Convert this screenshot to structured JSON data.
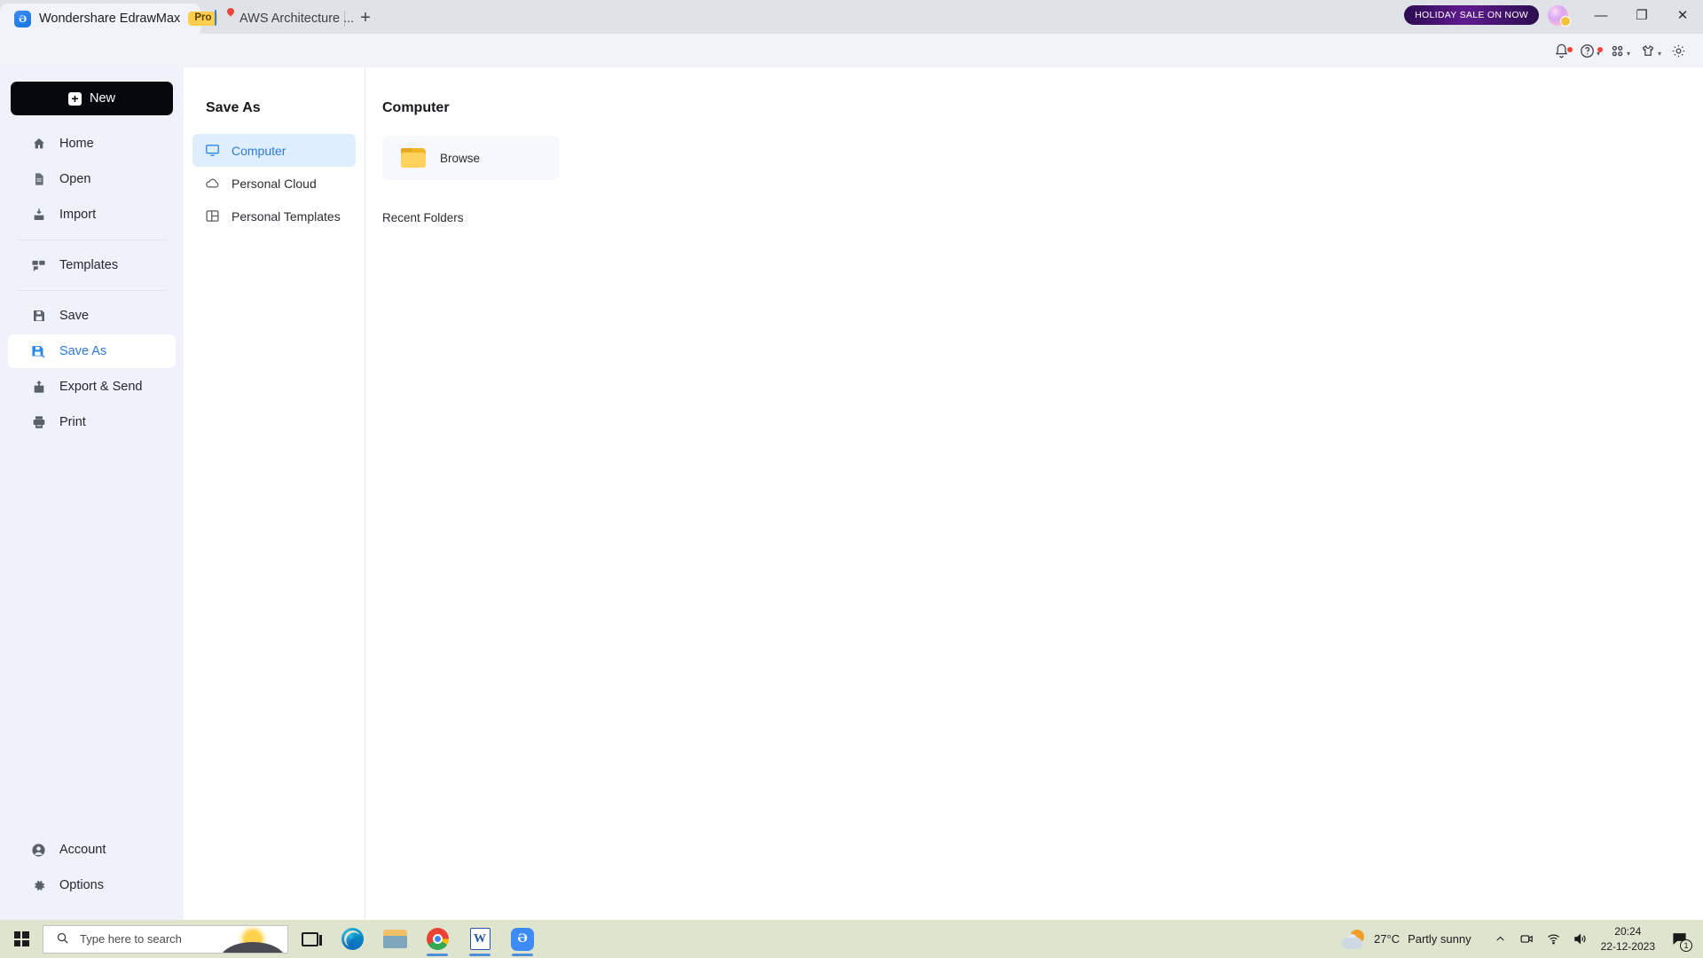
{
  "window": {
    "tabs": [
      {
        "title": "Wondershare EdrawMax",
        "badge": "Pro",
        "icon": "edrawmax-logo",
        "active": true
      },
      {
        "title": "AWS Architecture ...",
        "icon": "document-icon",
        "active": false
      }
    ],
    "new_tab_label": "+",
    "promo_badge": "HOLIDAY SALE ON NOW",
    "controls": {
      "minimize": "—",
      "restore": "❐",
      "close": "✕"
    }
  },
  "topbar": {
    "icons": [
      {
        "name": "notifications-bell-icon",
        "dot": true,
        "chevron": false
      },
      {
        "name": "help-question-icon",
        "dot": true,
        "chevron": true
      },
      {
        "name": "apps-grid-icon",
        "dot": false,
        "chevron": true
      },
      {
        "name": "theme-shirt-icon",
        "dot": false,
        "chevron": true
      },
      {
        "name": "settings-gear-icon",
        "dot": false,
        "chevron": false
      }
    ]
  },
  "sidebar": {
    "new_button": "New",
    "items": [
      {
        "label": "Home",
        "icon": "home-icon"
      },
      {
        "label": "Open",
        "icon": "open-file-icon"
      },
      {
        "label": "Import",
        "icon": "import-icon"
      },
      {
        "label": "Templates",
        "icon": "templates-icon"
      },
      {
        "label": "Save",
        "icon": "save-icon"
      },
      {
        "label": "Save As",
        "icon": "save-as-icon"
      },
      {
        "label": "Export & Send",
        "icon": "export-send-icon"
      },
      {
        "label": "Print",
        "icon": "print-icon"
      }
    ],
    "active_item": "Save As",
    "bottom_items": [
      {
        "label": "Account",
        "icon": "account-icon"
      },
      {
        "label": "Options",
        "icon": "options-gear-icon"
      }
    ]
  },
  "midpanel": {
    "title": "Save As",
    "items": [
      {
        "label": "Computer",
        "icon": "monitor-icon"
      },
      {
        "label": "Personal Cloud",
        "icon": "cloud-icon"
      },
      {
        "label": "Personal Templates",
        "icon": "templates-panel-icon"
      }
    ],
    "active_item": "Computer"
  },
  "content": {
    "title": "Computer",
    "browse_label": "Browse",
    "browse_icon": "folder-icon",
    "recent_folders_title": "Recent Folders",
    "recent_folders": []
  },
  "taskbar": {
    "search_placeholder": "Type here to search",
    "apps": [
      {
        "name": "task-view-icon",
        "running": false
      },
      {
        "name": "microsoft-edge-icon",
        "running": false
      },
      {
        "name": "file-explorer-icon",
        "running": false
      },
      {
        "name": "google-chrome-icon",
        "running": true
      },
      {
        "name": "microsoft-word-icon",
        "running": true
      },
      {
        "name": "edrawmax-icon",
        "running": true
      }
    ],
    "weather": {
      "temperature": "27°C",
      "condition": "Partly sunny"
    },
    "tray_icons": [
      "show-hidden-icons-chevron",
      "meet-now-icon",
      "network-wifi-icon",
      "volume-icon"
    ],
    "clock": {
      "time": "20:24",
      "date": "22-12-2023"
    },
    "notification_count": "1"
  },
  "colors": {
    "accent_blue": "#2d79d6",
    "sidebar_bg": "#eff2fa",
    "active_mid_bg": "#dfeefc",
    "taskbar_bg": "#dfe4cf",
    "folder_yellow": "#ffd25e",
    "pro_badge": "#ffce4f"
  }
}
